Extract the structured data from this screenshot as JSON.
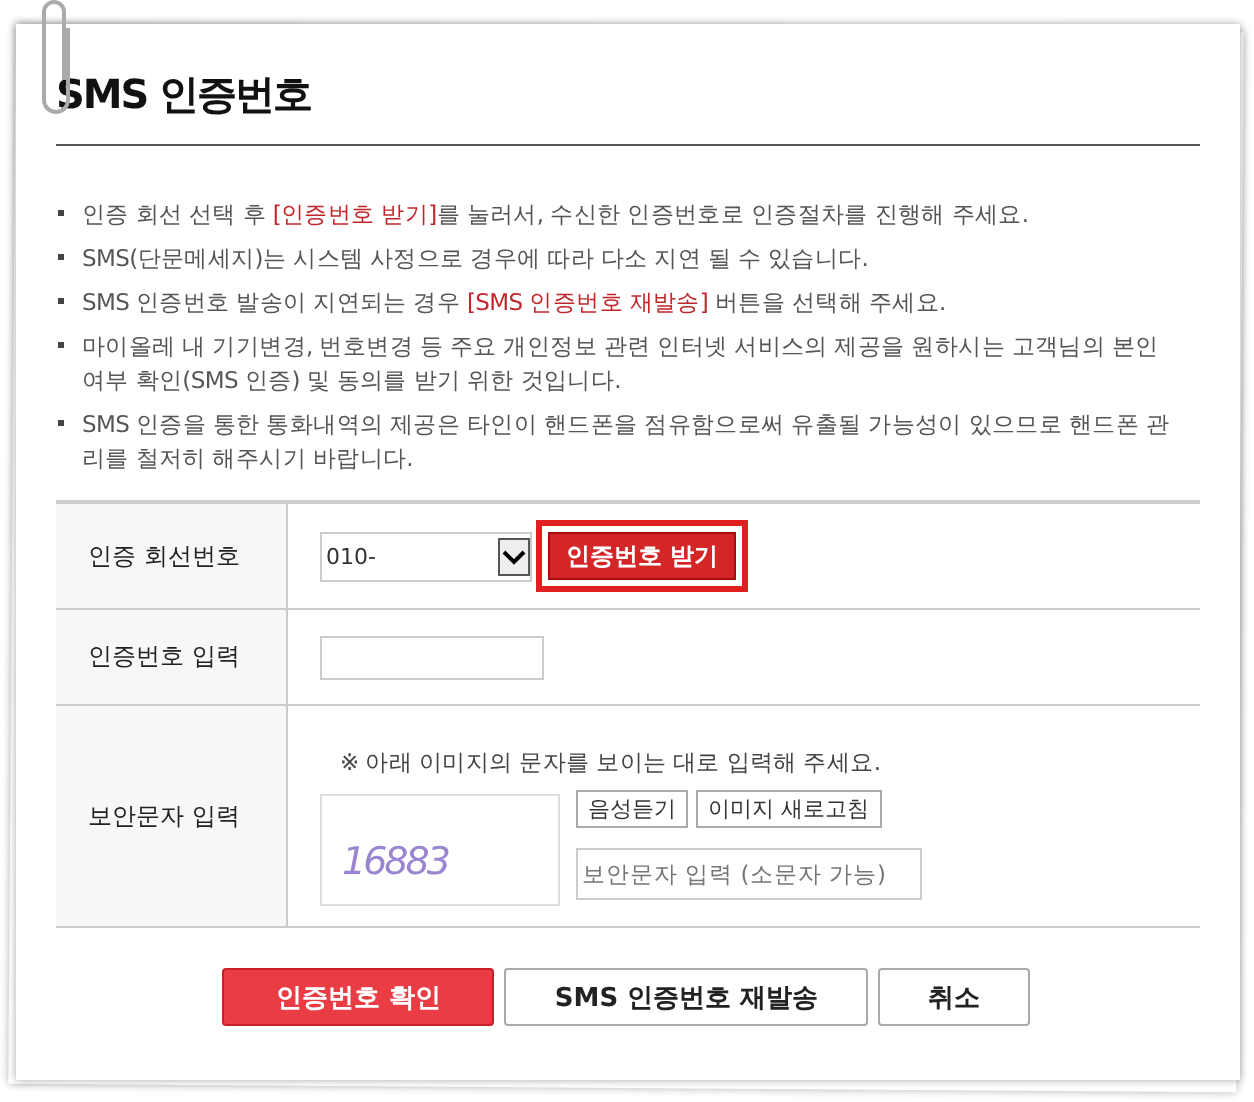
{
  "title": "SMS 인증번호",
  "notices": [
    {
      "text": "인증 회선 선택 후 **[인증번호 받기]**를 눌러서, 수신한 인증번호로 인증절차를 진행해 주세요."
    },
    {
      "text": "SMS(단문메세지)는 시스템 사정으로 경우에 따라 다소 지연 될 수 있습니다."
    },
    {
      "text": "SMS 인증번호 발송이 지연되는 경우 **[SMS 인증번호 재발송]** 버튼을 선택해 주세요."
    },
    {
      "text": "마이올레 내 기기변경, 번호변경 등 주요 개인정보 관련 인터넷 서비스의 제공을 원하시는 고객님의 본인여부 확인(SMS 인증) 및 동의를 받기 위한 것입니다."
    },
    {
      "text": "SMS 인증을 통한 통화내역의 제공은 타인이 핸드폰을 점유함으로써 유출될 가능성이 있으므로 핸드폰 관리를 철저히 해주시기 바랍니다."
    }
  ],
  "form": [
    {
      "kind": "phone",
      "label": "인증 회선번호",
      "select_value": "010-",
      "button": {
        "label": "인증번호 받기",
        "highlighted": true
      }
    },
    {
      "kind": "code",
      "label": "인증번호 입력"
    },
    {
      "kind": "captcha",
      "label": "보안문자 입력",
      "hint": "※ 아래 이미지의 문자를 보이는 대로 입력해 주세요.",
      "captcha_text": "16883",
      "buttons": [
        "음성듣기",
        "이미지 새로고침"
      ],
      "placeholder": "보안문자 입력 (소문자 가능)"
    }
  ],
  "actions": [
    {
      "label": "인증번호 확인",
      "primary": true
    },
    {
      "label": "SMS 인증번호 재발송",
      "primary": false
    },
    {
      "label": "취소",
      "primary": false
    }
  ]
}
